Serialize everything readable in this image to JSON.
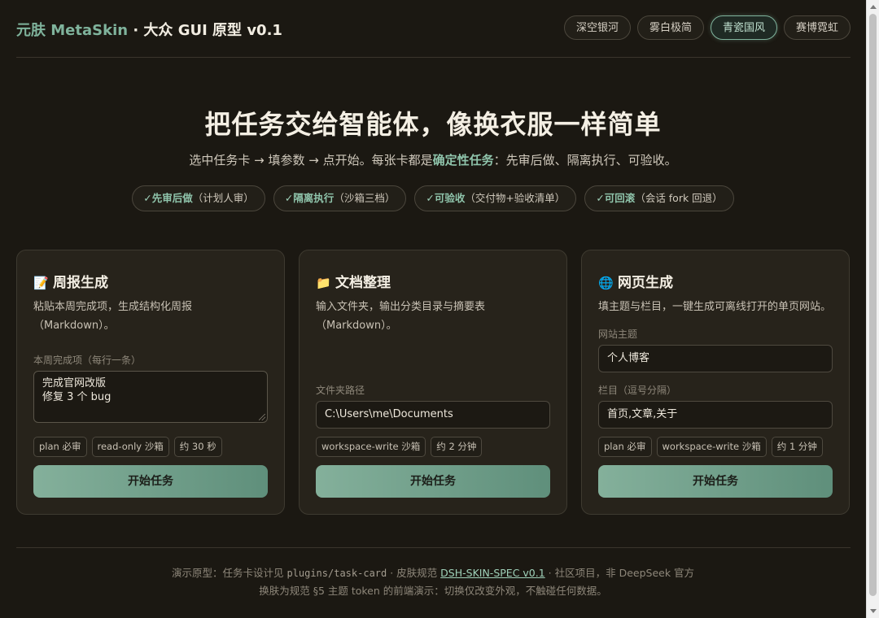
{
  "header": {
    "brand_accent": "元肤 MetaSkin",
    "brand_rest": " · 大众 GUI 原型 v0.1",
    "skins": [
      {
        "label": "深空银河",
        "active": false
      },
      {
        "label": "雾白极简",
        "active": false
      },
      {
        "label": "青瓷国风",
        "active": true
      },
      {
        "label": "赛博霓虹",
        "active": false
      }
    ]
  },
  "hero": {
    "title": "把任务交给智能体，像换衣服一样简单",
    "sub_before": "选中任务卡 → 填参数 → 点开始。每张卡都是",
    "sub_bold": "确定性任务",
    "sub_after": "：先审后做、隔离执行、可验收。",
    "pills": [
      {
        "check": "✓",
        "bold": "先审后做",
        "note": "（计划人审）"
      },
      {
        "check": "✓",
        "bold": "隔离执行",
        "note": "（沙箱三档）"
      },
      {
        "check": "✓",
        "bold": "可验收",
        "note": "（交付物+验收清单）"
      },
      {
        "check": "✓",
        "bold": "可回滚",
        "note": "（会话 fork 回退）"
      }
    ]
  },
  "cards": [
    {
      "icon": "📝",
      "icon_name": "memo-icon",
      "title": "周报生成",
      "desc": "粘贴本周完成项，生成结构化周报（Markdown）。",
      "field_label": "本周完成项（每行一条）",
      "textarea_lines": [
        "完成官网改版",
        "修复 3 个 bug"
      ],
      "tags": [
        "plan 必审",
        "read-only 沙箱",
        "约 30 秒"
      ],
      "button": "开始任务"
    },
    {
      "icon": "📁",
      "icon_name": "folder-icon",
      "title": "文档整理",
      "desc": "输入文件夹，输出分类目录与摘要表（Markdown）。",
      "field_label": "文件夹路径",
      "input_value": "C:\\Users\\me\\Documents",
      "tags": [
        "workspace-write 沙箱",
        "约 2 分钟"
      ],
      "button": "开始任务"
    },
    {
      "icon": "🌐",
      "icon_name": "globe-icon",
      "title": "网页生成",
      "desc": "填主题与栏目，一键生成可离线打开的单页网站。",
      "field1_label": "网站主题",
      "field1_value": "个人博客",
      "field2_label": "栏目（逗号分隔）",
      "field2_value": "首页,文章,关于",
      "tags": [
        "plan 必审",
        "workspace-write 沙箱",
        "约 1 分钟"
      ],
      "button": "开始任务"
    }
  ],
  "footer": {
    "line1_prefix": "演示原型：任务卡设计见 ",
    "line1_code": "plugins/task-card",
    "line1_mid": " · 皮肤规范 ",
    "line1_link": "DSH-SKIN-SPEC v0.1",
    "line1_suffix": " · 社区项目，非 DeepSeek 官方",
    "line2": "换肤为规范 §5 主题 token 的前端演示：切换仅改变外观，不触碰任何数据。"
  }
}
